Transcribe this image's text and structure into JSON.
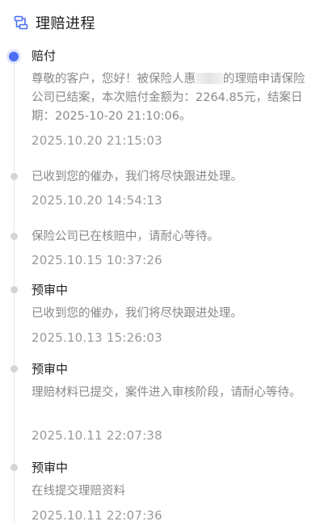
{
  "header": {
    "title": "理赔进程",
    "icon": "process-icon"
  },
  "accent_color": "#4b6ef5",
  "timeline": [
    {
      "status": "赔付",
      "desc_before_mask": "尊敬的客户，您好！被保险人惠",
      "desc_after_mask": "的理赔申请保险公司已结案，本次赔付金额为：2264.85元，结案日期：2025-10-20 21:10:06。",
      "time": "2025.10.20 21:15:03"
    },
    {
      "status": "",
      "desc": "已收到您的催办，我们将尽快跟进处理。",
      "time": "2025.10.20 14:54:13"
    },
    {
      "status": "",
      "desc": "保险公司已在核赔中，请耐心等待。",
      "time": "2025.10.15 10:37:26"
    },
    {
      "status": "预审中",
      "desc": "已收到您的催办，我们将尽快跟进处理。",
      "time": "2025.10.13 15:26:03"
    },
    {
      "status": "预审中",
      "desc": "理赔材料已提交，案件进入审核阶段，请耐心等待。",
      "time": "2025.10.11 22:07:38"
    },
    {
      "status": "预审中",
      "desc": "在线提交理赔资料",
      "time": "2025.10.11 22:07:36"
    }
  ]
}
